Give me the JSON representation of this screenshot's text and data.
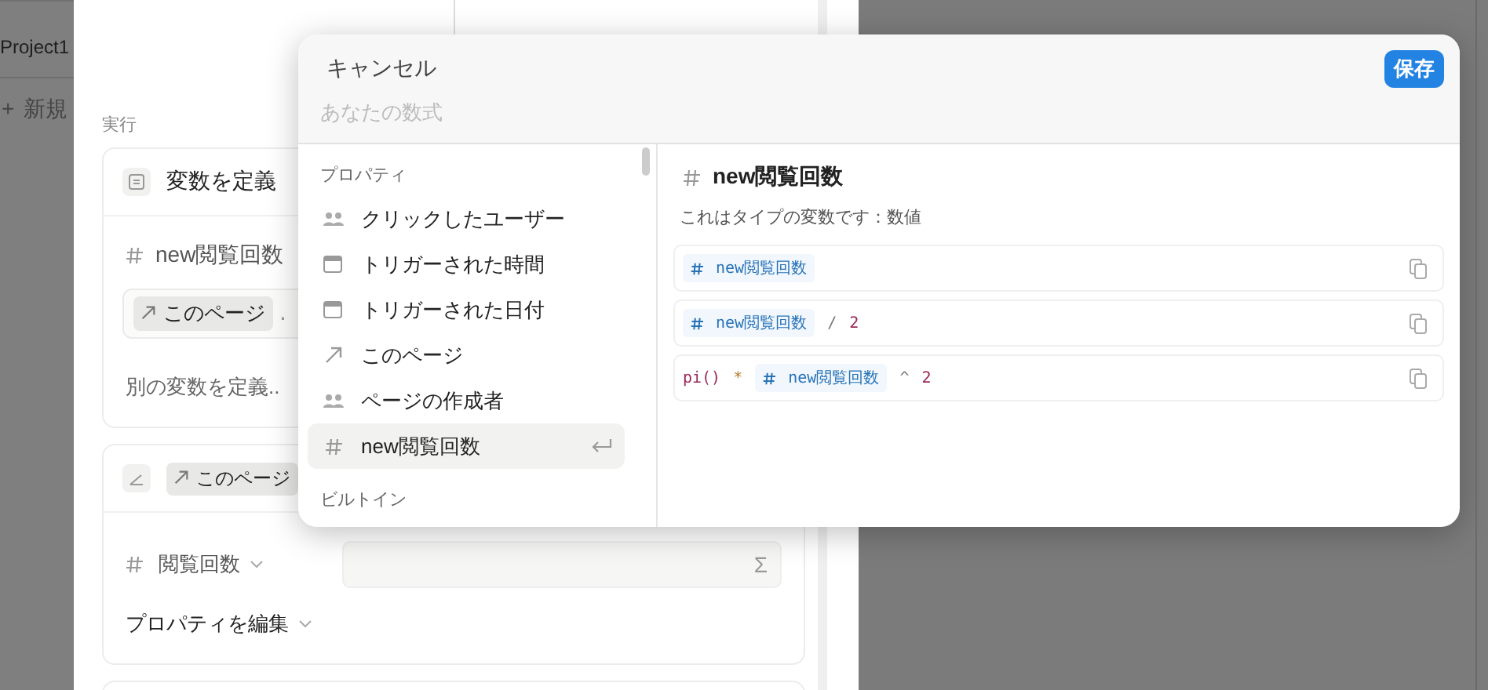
{
  "sidebar": {
    "project": "Project1",
    "new_label": "新規",
    "plus": "+"
  },
  "editor": {
    "section_label": "実行",
    "define_card": {
      "title": "変数を定義",
      "variable": "new閲覧回数",
      "chip": "このページ",
      "chip_suffix": ".",
      "add_another": "別の変数を定義.."
    },
    "edit_card": {
      "chip": "このページ",
      "property": "閲覧回数",
      "edit_label": "プロパティを編集",
      "sum_symbol": "Σ"
    }
  },
  "formula_popup": {
    "cancel": "キャンセル",
    "save": "保存",
    "placeholder": "あなたの数式",
    "groups": [
      {
        "title": "プロパティ",
        "items": [
          {
            "kind": "people",
            "label": "クリックしたユーザー",
            "selected": false
          },
          {
            "kind": "calendar",
            "label": "トリガーされた時間",
            "selected": false
          },
          {
            "kind": "calendar",
            "label": "トリガーされた日付",
            "selected": false
          },
          {
            "kind": "arrow",
            "label": "このページ",
            "selected": false
          },
          {
            "kind": "people",
            "label": "ページの作成者",
            "selected": false
          },
          {
            "kind": "number",
            "label": "new閲覧回数",
            "selected": true
          }
        ]
      },
      {
        "title": "ビルトイン"
      }
    ],
    "detail": {
      "title": "new閲覧回数",
      "description": "これはタイプの変数です：数値",
      "examples": [
        [
          {
            "kind": "prop",
            "text": "new閲覧回数"
          }
        ],
        [
          {
            "kind": "prop",
            "text": "new閲覧回数"
          },
          {
            "kind": "op",
            "text": "/"
          },
          {
            "kind": "num",
            "text": "2"
          }
        ],
        [
          {
            "kind": "func",
            "text": "pi()"
          },
          {
            "kind": "op2",
            "text": "*"
          },
          {
            "kind": "prop",
            "text": "new閲覧回数"
          },
          {
            "kind": "op",
            "text": "^"
          },
          {
            "kind": "num",
            "text": "2"
          }
        ]
      ]
    }
  }
}
